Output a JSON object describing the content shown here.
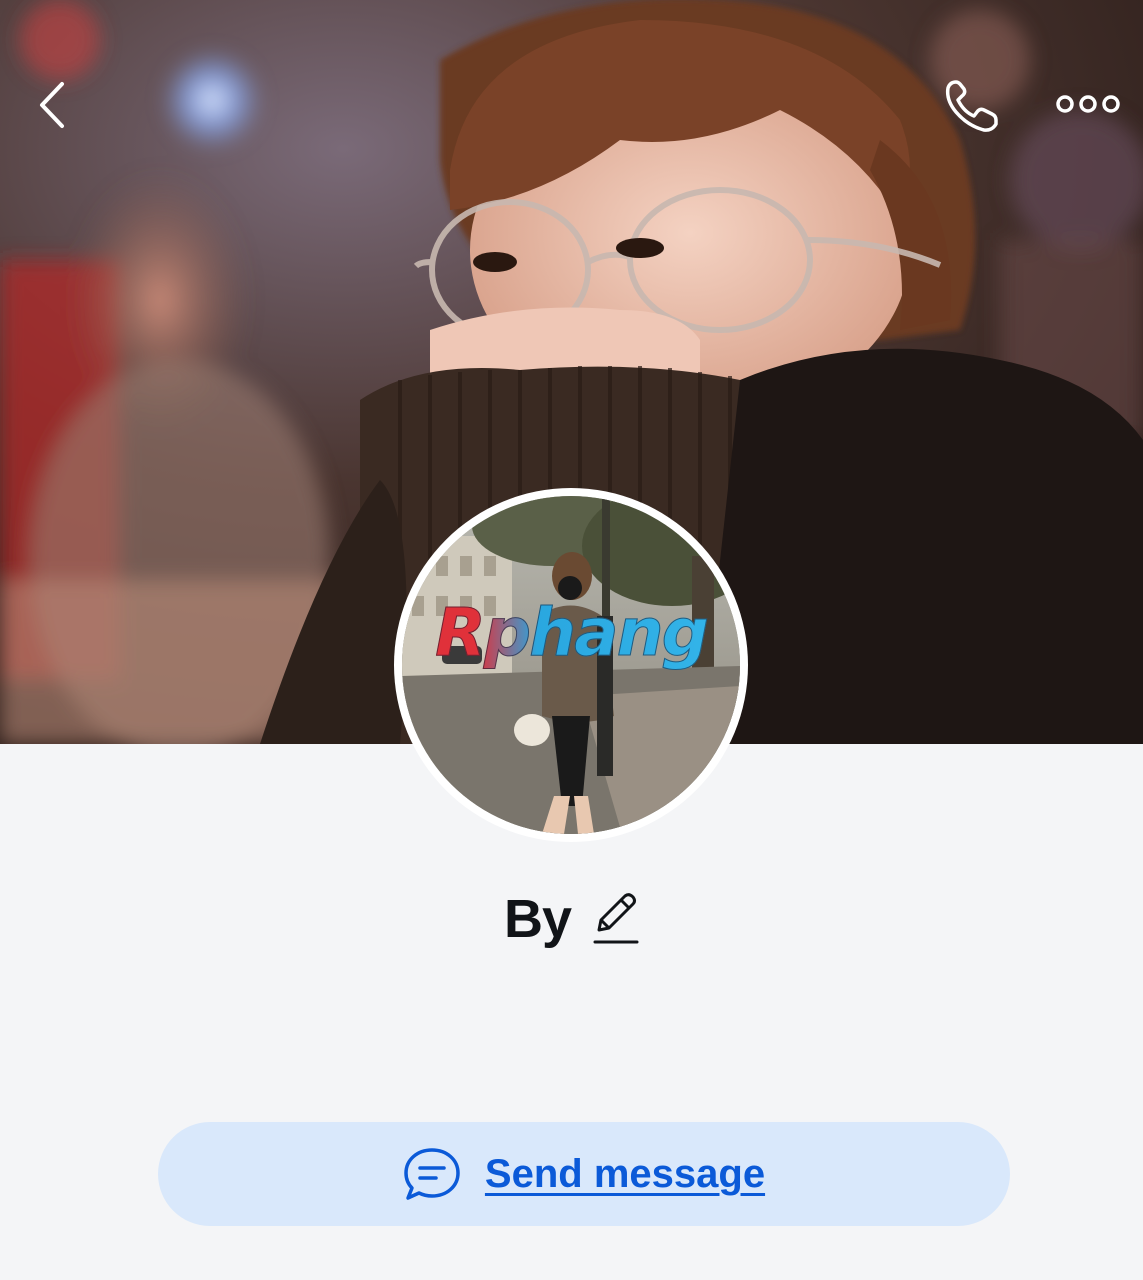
{
  "header": {
    "back_icon": "chevron-left-icon",
    "call_icon": "phone-icon",
    "more_icon": "more-dots-icon"
  },
  "cover": {
    "image": "cover-photo"
  },
  "avatar": {
    "image": "profile-photo",
    "watermark_text": "Rphang"
  },
  "profile": {
    "name": "By",
    "edit_icon": "pencil-icon"
  },
  "actions": {
    "send_message_label": "Send message",
    "send_message_icon": "chat-bubble-icon"
  },
  "colors": {
    "accent": "#0b5ad8",
    "button_bg": "#d9e8fb",
    "page_bg": "#f4f5f7"
  }
}
